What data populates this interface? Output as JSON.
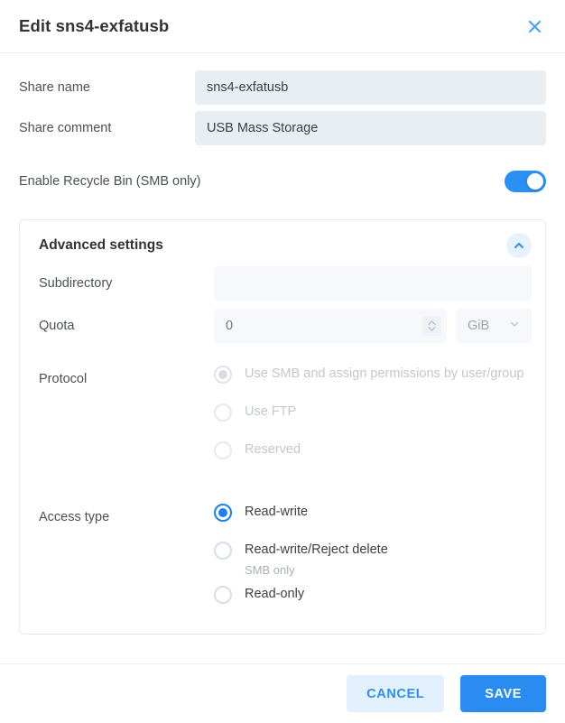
{
  "dialog": {
    "title": "Edit sns4-exfatusb",
    "close_icon": "close-icon"
  },
  "form": {
    "share_name": {
      "label": "Share name",
      "value": "sns4-exfatusb",
      "placeholder": ""
    },
    "share_comment": {
      "label": "Share comment",
      "value": "USB Mass Storage",
      "placeholder": ""
    },
    "recycle_bin": {
      "label": "Enable Recycle Bin (SMB only)",
      "state": "on"
    }
  },
  "advanced": {
    "title": "Advanced settings",
    "collapse_icon": "chevron-up-icon",
    "subdirectory": {
      "label": "Subdirectory",
      "value": "",
      "placeholder": ""
    },
    "quota": {
      "label": "Quota",
      "value": "",
      "placeholder": "0",
      "spinner_icon": "spinner-up-down-icon",
      "unit": "GiB",
      "unit_icon": "chevron-down-icon"
    },
    "protocol": {
      "label": "Protocol",
      "options": [
        {
          "label": "Use SMB and assign permissions by user/group",
          "selected": true
        },
        {
          "label": "Use FTP",
          "selected": false
        },
        {
          "label": "Reserved",
          "selected": false
        }
      ]
    },
    "access_type": {
      "label": "Access type",
      "options": [
        {
          "label": "Read-write",
          "sub": "",
          "selected": true
        },
        {
          "label": "Read-write/Reject delete",
          "sub": "SMB only",
          "selected": false
        },
        {
          "label": "Read-only",
          "sub": "",
          "selected": false
        }
      ]
    }
  },
  "footer": {
    "cancel_label": "CANCEL",
    "save_label": "SAVE"
  },
  "colors": {
    "accent": "#2a8cf0",
    "accent_light": "#e3f0fd",
    "input_bg": "#e9eef3",
    "disabled_bg": "#f6f8fb",
    "text": "#3c4043",
    "muted": "#9aa3ab"
  }
}
